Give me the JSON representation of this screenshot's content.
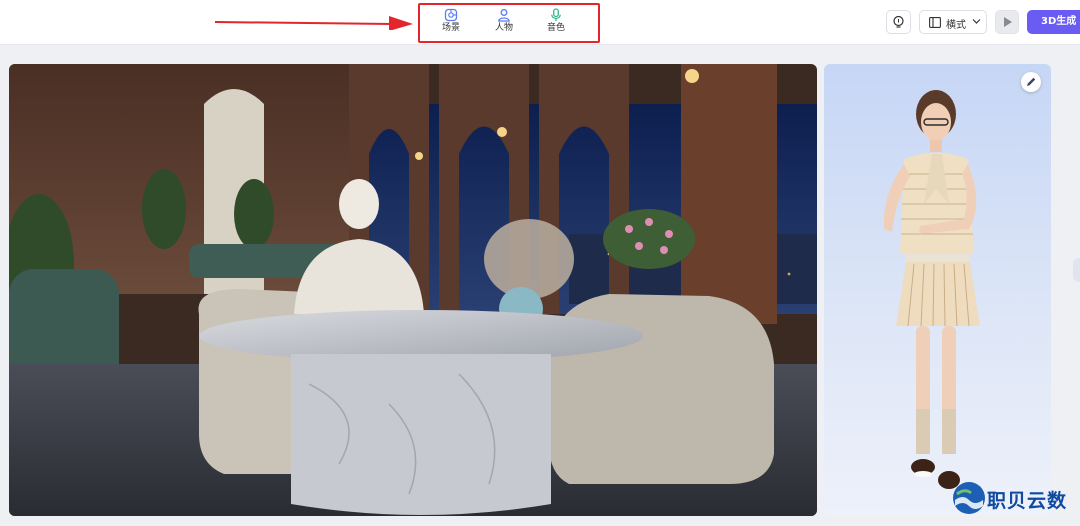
{
  "toolbar": {
    "scene_label": "场景",
    "person_label": "人物",
    "voice_label": "音色",
    "orientation_label": "横式",
    "generate_label": "3D生成"
  },
  "icons": {
    "scene": "scene-icon",
    "person": "person-icon",
    "voice": "microphone-icon",
    "mic_button": "bulb-icon",
    "orientation": "layout-icon",
    "play": "play-icon",
    "edit": "pencil-icon"
  },
  "colors": {
    "accent": "#6a5cf2",
    "annotation": "#e3262b"
  },
  "watermark": {
    "text": "职贝云数"
  }
}
